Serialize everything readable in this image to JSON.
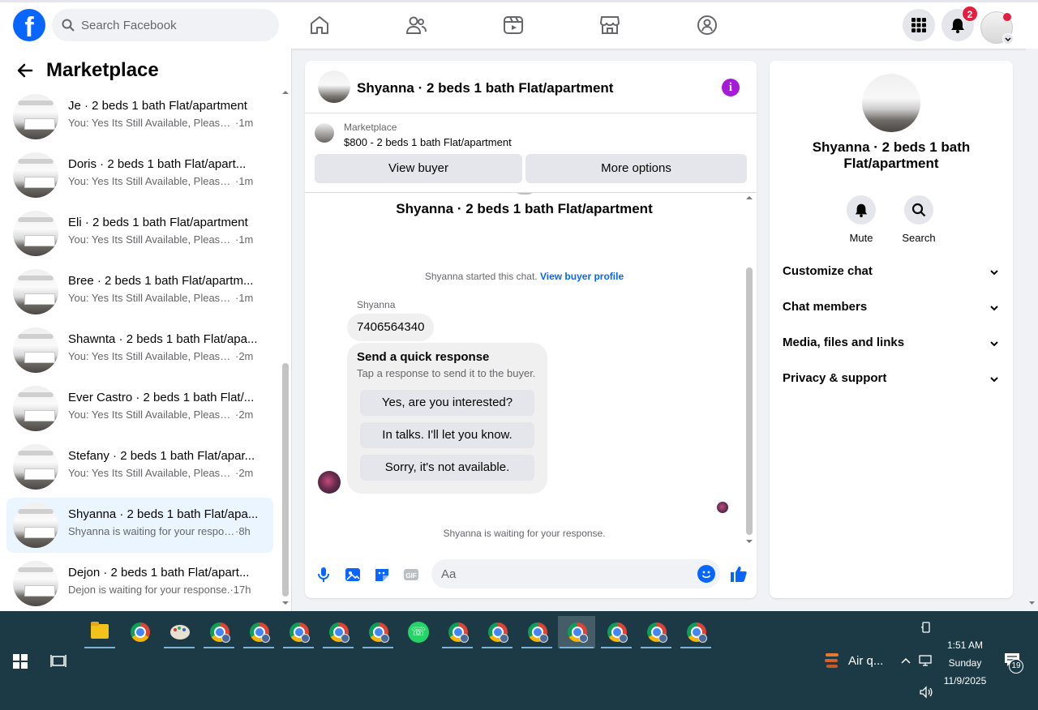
{
  "topbar": {
    "logo": "f",
    "search_placeholder": "Search Facebook",
    "notification_count": "2",
    "nav_icons": [
      "home-icon",
      "friends-icon",
      "video-icon",
      "marketplace-icon",
      "groups-icon"
    ]
  },
  "sidebar": {
    "title": "Marketplace",
    "conversations": [
      {
        "title": "Je · 2 beds 1 bath Flat/apartment",
        "preview": "You: Yes Its Still Available, Please S...",
        "time": "·1m",
        "active": false
      },
      {
        "title": "Doris · 2 beds 1 bath Flat/apart...",
        "preview": "You: Yes Its Still Available, Please S...",
        "time": "·1m",
        "active": false
      },
      {
        "title": "Eli · 2 beds 1 bath Flat/apartment",
        "preview": "You: Yes Its Still Available, Please S...",
        "time": "·1m",
        "active": false
      },
      {
        "title": "Bree · 2 beds 1 bath Flat/apartm...",
        "preview": "You: Yes Its Still Available, Please S...",
        "time": "·1m",
        "active": false
      },
      {
        "title": "Shawnta · 2 beds 1 bath Flat/apa...",
        "preview": "You: Yes Its Still Available, Please S...",
        "time": "·2m",
        "active": false
      },
      {
        "title": "Ever Castro · 2 beds 1 bath Flat/...",
        "preview": "You: Yes Its Still Available, Please S...",
        "time": "·2m",
        "active": false
      },
      {
        "title": "Stefany · 2 beds 1 bath Flat/apar...",
        "preview": "You: Yes Its Still Available, Please S...",
        "time": "·2m",
        "active": false
      },
      {
        "title": "Shyanna · 2 beds 1 bath Flat/apa...",
        "preview": "Shyanna is waiting for your respon...",
        "time": "·8h",
        "active": true
      },
      {
        "title": "Dejon · 2 beds 1 bath Flat/apart...",
        "preview": "Dejon is waiting for your response.",
        "time": "·17h",
        "active": false
      }
    ]
  },
  "chat": {
    "title": "Shyanna · 2 beds 1 bath Flat/apartment",
    "marketplace_label": "Marketplace",
    "listing": "$800 - 2 beds 1 bath Flat/apartment",
    "view_buyer_label": "View buyer",
    "more_options_label": "More options",
    "thread_title": "Shyanna · 2 beds 1 bath Flat/apartment",
    "started_text": "Shyanna started this chat.",
    "view_profile_link": "View buyer profile",
    "sender_name": "Shyanna",
    "message": "7406564340",
    "quick_title": "Send a quick response",
    "quick_subtitle": "Tap a response to send it to the buyer.",
    "quick_responses": [
      "Yes, are you interested?",
      "In talks. I'll let you know.",
      "Sorry, it's not available."
    ],
    "waiting_text": "Shyanna is waiting for your response.",
    "composer_placeholder": "Aa"
  },
  "details": {
    "name": "Shyanna · 2 beds 1 bath Flat/apartment",
    "mute_label": "Mute",
    "search_label": "Search",
    "sections": [
      "Customize chat",
      "Chat members",
      "Media, files and links",
      "Privacy & support"
    ]
  },
  "taskbar": {
    "weather": "Air q...",
    "time": "1:51 AM",
    "day": "Sunday",
    "date": "11/9/2025",
    "notifications": "19"
  }
}
